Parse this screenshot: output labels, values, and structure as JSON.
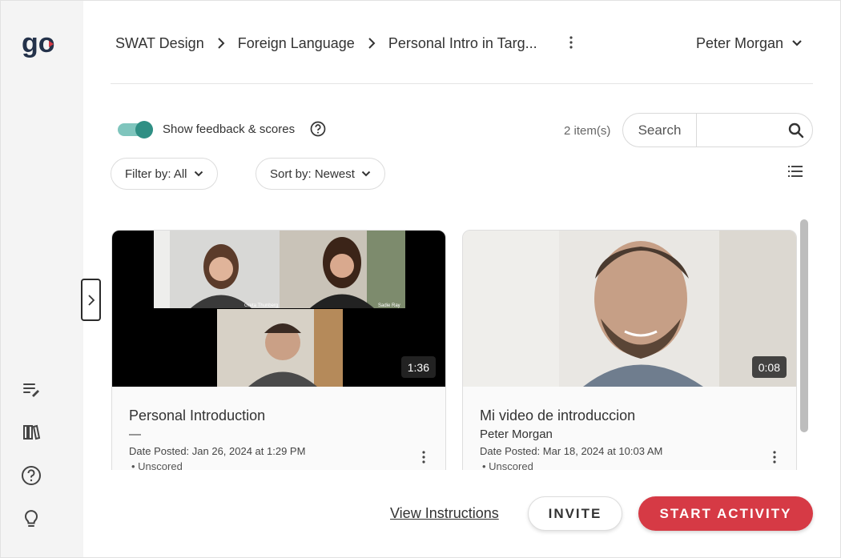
{
  "app": {
    "logo_text": "go",
    "brand_color": "#d63a45",
    "accent_color": "#2f8f84"
  },
  "sidebar": {
    "collapse_icon": "chevron-right-icon",
    "items": [
      {
        "name": "activity-feed",
        "icon": "list-edit-icon"
      },
      {
        "name": "library",
        "icon": "library-books-icon"
      },
      {
        "name": "help",
        "icon": "help-circle-icon"
      },
      {
        "name": "ideas",
        "icon": "lightbulb-icon"
      }
    ]
  },
  "breadcrumb": {
    "items": [
      "SWAT Design",
      "Foreign Language",
      "Personal Intro in Targ..."
    ]
  },
  "user": {
    "name": "Peter Morgan"
  },
  "controls": {
    "feedback_toggle_label": "Show feedback & scores",
    "feedback_toggle_on": true,
    "item_count": "2 item(s)",
    "search_label": "Search",
    "search_value": "",
    "filter_label": "Filter by: All",
    "sort_label": "Sort by: Newest"
  },
  "cards": [
    {
      "title": "Personal Introduction",
      "author": "—",
      "date": "Date Posted: Jan 26, 2024 at 1:29 PM",
      "status": "• Unscored",
      "duration": "1:36",
      "thumb_labels": [
        "Greta Thunberg",
        "Sadie Ray"
      ]
    },
    {
      "title": "Mi video de introduccion",
      "author": "Peter Morgan",
      "date": "Date Posted: Mar 18, 2024 at 10:03 AM",
      "status": "• Unscored",
      "duration": "0:08"
    }
  ],
  "footer": {
    "view_instructions": "View Instructions",
    "invite": "INVITE",
    "start_activity": "START ACTIVITY"
  }
}
